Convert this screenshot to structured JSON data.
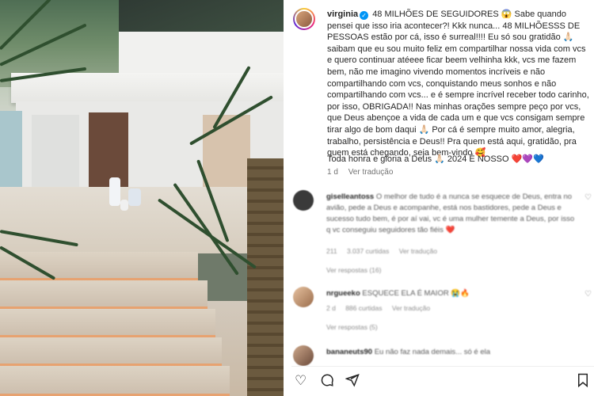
{
  "post": {
    "username": "virginia",
    "caption": "48 MILHÕES DE SEGUIDORES 😱 Sabe quando pensei que isso iria acontecer?! Kkk nunca... 48 MILHÕESSS DE PESSOAS estão por cá, isso é surreal!!!! Eu só sou gratidão 🙏🏻 saibam que eu sou muito feliz em compartilhar nossa vida com vcs e quero continuar atéeee ficar beem velhinha kkk, vcs me fazem bem, não me imagino vivendo momentos incríveis e não compartilhando com vcs, conquistando meus sonhos e não compartilhando com vcs... e é sempre incrível receber todo carinho, por isso, OBRIGADA!! Nas minhas orações sempre peço por vcs, que Deus abençoe a vida de cada um e que vcs consigam sempre tirar algo de bom daqui 🙏🏻 Por cá é sempre muito amor, alegria, trabalho, persistência e Deus!! Pra quem está aqui, gratidão, pra quem está chegando, seja bem-vindo 🥰",
    "caption_line2": "Toda honra e gloria a Deus 🙏🏻 2024 É NOSSO ❤️💜💙",
    "time": "1 d",
    "translate": "Ver tradução"
  },
  "comments": [
    {
      "username": "giselleantoss",
      "text": "O melhor de tudo é a nunca se esquece de Deus, entra no avião, pede a Deus e acompanhe, está nos bastidores, pede a Deus e sucesso tudo bem, é por aí vai, vc é uma mulher temente a Deus, por isso q vc conseguiu seguidores tão fiéis ❤️",
      "likes": "211",
      "reply_count": "3.037 curtidas",
      "translate": "Ver tradução",
      "replies": "Ver respostas (16)"
    },
    {
      "username": "nrgueeko",
      "text": "ESQUECE ELA É MAIOR 😭🔥",
      "likes": "2 d",
      "reply_count": "886 curtidas",
      "translate": "Ver tradução",
      "replies": "Ver respostas (5)"
    },
    {
      "username": "bananeuts90",
      "text": "Eu não faz nada demais... só é ela"
    }
  ],
  "actions": {
    "like": "heart-icon",
    "comment": "comment-icon",
    "share": "share-icon",
    "save": "save-icon"
  },
  "colors": {
    "verified": "#0095f6",
    "muted": "#737373"
  }
}
